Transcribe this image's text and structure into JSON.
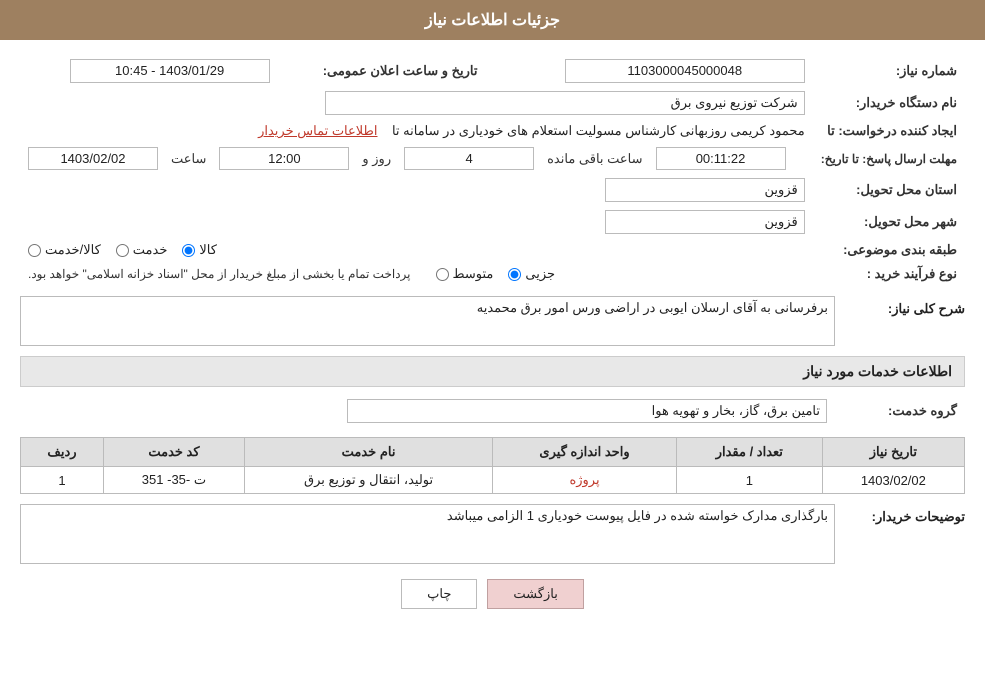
{
  "header": {
    "title": "جزئیات اطلاعات نیاز"
  },
  "form": {
    "need_number_label": "شماره نیاز:",
    "need_number_value": "1103000045000048",
    "buyer_org_label": "نام دستگاه خریدار:",
    "buyer_org_value": "شرکت توزیع نیروی برق",
    "announce_date_label": "تاریخ و ساعت اعلان عمومی:",
    "announce_date_value": "1403/01/29 - 10:45",
    "creator_label": "ایجاد کننده درخواست: تا",
    "creator_name": "محمود کریمی روزبهانی کارشناس  مسولیت استعلام های خودیاری در سامانه تا",
    "creator_link": "اطلاعات تماس خریدار",
    "deadline_label": "مهلت ارسال پاسخ: تا تاریخ:",
    "deadline_date": "1403/02/02",
    "deadline_time_label": "ساعت",
    "deadline_time_value": "12:00",
    "deadline_day_label": "روز و",
    "deadline_days_value": "4",
    "deadline_remaining_label": "ساعت باقی مانده",
    "deadline_remaining_value": "00:11:22",
    "province_label": "استان محل تحویل:",
    "province_value": "قزوین",
    "city_label": "شهر محل تحویل:",
    "city_value": "قزوین",
    "category_label": "طبقه بندی موضوعی:",
    "category_radio1": "کالا",
    "category_radio2": "خدمت",
    "category_radio3": "کالا/خدمت",
    "purchase_type_label": "نوع فرآیند خرید :",
    "purchase_radio1": "جزیی",
    "purchase_radio2": "متوسط",
    "purchase_note": "پرداخت تمام یا بخشی از مبلغ خریدار از محل \"اسناد خزانه اسلامی\" خواهد بود.",
    "description_label": "شرح کلی نیاز:",
    "description_value": "برفرسانی به آقای ارسلان ایوبی در اراضی ورس امور برق محمدیه",
    "services_header": "اطلاعات خدمات مورد نیاز",
    "service_group_label": "گروه خدمت:",
    "service_group_value": "تامین برق، گاز، بخار و تهویه هوا",
    "table": {
      "col_row": "ردیف",
      "col_code": "کد خدمت",
      "col_name": "نام خدمت",
      "col_unit": "واحد اندازه گیری",
      "col_quantity": "تعداد / مقدار",
      "col_date": "تاریخ نیاز",
      "rows": [
        {
          "row": "1",
          "code": "ت -35- 351",
          "name": "تولید، انتقال و توزیع برق",
          "unit": "پروژه",
          "quantity": "1",
          "date": "1403/02/02"
        }
      ]
    },
    "buyer_desc_label": "توضیحات خریدار:",
    "buyer_desc_value": "بارگذاری مدارک خواسته شده در فایل پیوست خودیاری 1 الزامی میباشد",
    "btn_print": "چاپ",
    "btn_back": "بازگشت"
  }
}
